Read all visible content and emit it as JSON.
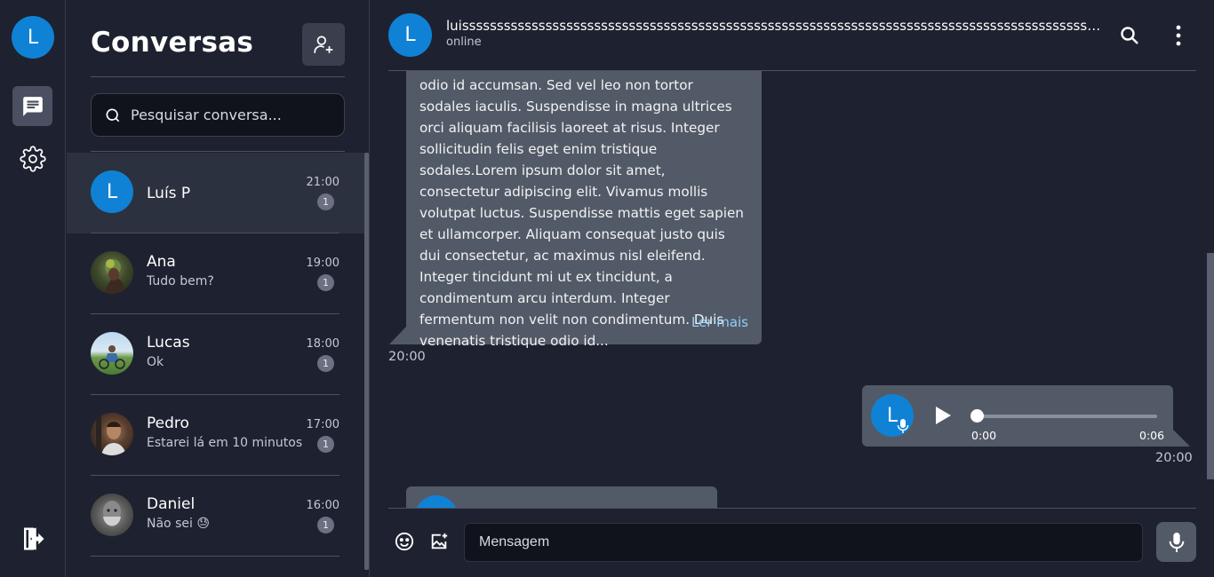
{
  "rail": {
    "me_initial": "L",
    "accent": "#0f82d6"
  },
  "list": {
    "title": "Conversas",
    "search_placeholder": "Pesquisar conversa...",
    "conversations": [
      {
        "name": "Luís P",
        "preview": "",
        "time": "21:00",
        "unread": "1",
        "initial": "L",
        "active": true
      },
      {
        "name": "Ana",
        "preview": "Tudo bem?",
        "time": "19:00",
        "unread": "1"
      },
      {
        "name": "Lucas",
        "preview": "Ok",
        "time": "18:00",
        "unread": "1"
      },
      {
        "name": "Pedro",
        "preview": "Estarei lá em 10 minutos",
        "time": "17:00",
        "unread": "1"
      },
      {
        "name": "Daniel",
        "preview": "Não sei 😓",
        "time": "16:00",
        "unread": "1"
      }
    ]
  },
  "chat": {
    "contact_initial": "L",
    "contact_name": "luissssssssssssssssssssssssssssssssssssssssssssssssssssssssssssssssssssssssssssssssssssssssssssssssssssss",
    "status": "online",
    "messages": {
      "incoming_text": "odio id accumsan. Sed vel leo non tortor sodales iaculis. Suspendisse in magna ultrices orci aliquam facilisis laoreet at risus. Integer sollicitudin felis eget enim tristique sodales.Lorem ipsum dolor sit amet, consectetur adipiscing elit. Vivamus mollis volutpat luctus. Suspendisse mattis eget sapien et ullamcorper. Aliquam consequat justo quis dui consectetur, ac maximus nisl eleifend. Integer tincidunt mi ut ex tincidunt, a condimentum arcu interdum. Integer fermentum non velit non condimentum. Duis venenatis tristique odio id...",
      "read_more": "Ler mais",
      "incoming_time": "20:00",
      "audio": {
        "avatar_initial": "L",
        "current": "0:00",
        "duration": "0:06",
        "progress": 0
      },
      "outgoing_time": "20:00"
    },
    "composer": {
      "placeholder": "Mensagem"
    }
  },
  "colors": {
    "background": "#1e2230",
    "bubble": "#535a67",
    "link": "#8fd0f5",
    "active_row": "#2c3140"
  }
}
